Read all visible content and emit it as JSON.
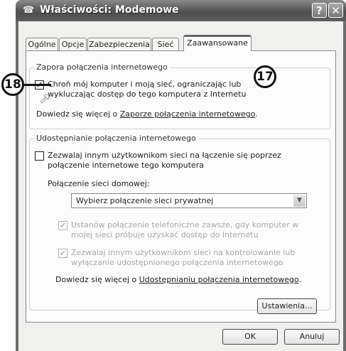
{
  "window": {
    "title": "Właściwości: Modemowe"
  },
  "title_buttons": {
    "help": "?",
    "close": "✕"
  },
  "tabs": [
    {
      "label": "Ogólne"
    },
    {
      "label": "Opcje"
    },
    {
      "label": "Zabezpieczenia"
    },
    {
      "label": "Sieć"
    },
    {
      "label": "Zaawansowane"
    }
  ],
  "firewall": {
    "legend": "Zapora połączenia internetowego",
    "checkbox_line1": "Chroń mój komputer i moją sieć, ograniczając lub",
    "checkbox_line2": "wykluczając dostęp do tego komputera z Internetu",
    "more_prefix": "Dowiedz się więcej o ",
    "more_link": "Zaporze połączenia internetowego",
    "more_suffix": "."
  },
  "sharing": {
    "legend": "Udostępnianie połączenia internetowego",
    "allow_line1": "Zezwalaj innym użytkownikom sieci na łączenie się poprzez",
    "allow_line2": "połączenie internetowe tego komputera",
    "home_label": "Połączenie sieci domowej:",
    "select_value": "Wybierz połączenie sieci prywatnej",
    "dial_line1": "Ustanów połączenie telefoniczne zawsze, gdy komputer w",
    "dial_line2": "mojej sieci próbuje uzyskać dostęp do Internetu",
    "control_line1": "Zezwalaj innym użytkownikom sieci na kontrolowanie lub",
    "control_line2": "wyłączanie udostępnionego połączenia internetowego",
    "more_prefix": "Dowiedz się więcej o ",
    "more_link": "Udostępnianiu połączenia internetowego",
    "more_suffix": "."
  },
  "buttons": {
    "settings": "Ustawienia...",
    "ok": "OK",
    "cancel": "Anuluj"
  },
  "callouts": {
    "c17": "17",
    "c18": "18"
  }
}
